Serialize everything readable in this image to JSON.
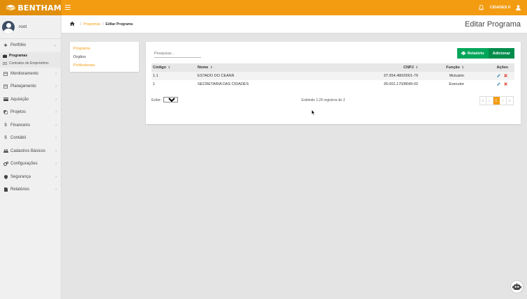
{
  "brand": {
    "name": "BENTHAM"
  },
  "topbar": {
    "user_city": "CIDADES II"
  },
  "user": {
    "name": "root"
  },
  "sidebar": {
    "items": [
      {
        "label": "Portfólio",
        "icon": "plus-icon",
        "expanded": true
      },
      {
        "label": "Monitoramento",
        "icon": "calendar-icon"
      },
      {
        "label": "Planejamento",
        "icon": "calendar-icon"
      },
      {
        "label": "Aquisição",
        "icon": "credit-card-icon"
      },
      {
        "label": "Projetos",
        "icon": "copy-icon"
      },
      {
        "label": "Financeiro",
        "icon": "dollar-icon"
      },
      {
        "label": "Contábil",
        "icon": "dollar-icon"
      },
      {
        "label": "Cadastros Básicos",
        "icon": "users-icon"
      },
      {
        "label": "Configurações",
        "icon": "cogs-icon"
      },
      {
        "label": "Segurança",
        "icon": "shield-icon"
      },
      {
        "label": "Relatórios",
        "icon": "file-icon"
      }
    ],
    "portfolio_sub": [
      {
        "label": "Programas",
        "icon": "briefcase-icon",
        "active": true
      },
      {
        "label": "Contratos de Empréstimo",
        "icon": "money-icon"
      }
    ]
  },
  "breadcrumb": {
    "programas": "Programas",
    "current": "Editar Programa",
    "separator": "/"
  },
  "page": {
    "title": "Editar Programa"
  },
  "tabs": [
    {
      "label": "Programa",
      "active": true
    },
    {
      "label": "Orgãos",
      "active": false
    },
    {
      "label": "Profissionais",
      "active": false
    }
  ],
  "search": {
    "placeholder": "Pesquisar..."
  },
  "buttons": {
    "report": "Relatório",
    "add": "Adicionar"
  },
  "table": {
    "headers": {
      "code": "Código",
      "name": "Nome",
      "cnpj": "CNPJ",
      "role": "Função",
      "actions": "Ações"
    },
    "sort_glyph": "⇕",
    "rows": [
      {
        "code": "1.1",
        "name": "ESTADO DO CEARÁ",
        "cnpj": "07.954.480/0001-79",
        "role": "Mutuário"
      },
      {
        "code": "1",
        "name": "SECRETARIA DAS CIDADES",
        "cnpj": "00.001.170/8649-02",
        "role": "Executor"
      }
    ]
  },
  "footer": {
    "show_label": "Exibir:",
    "page_size": "20",
    "info": "Exibindo 1-20 registros de 2"
  },
  "pagination": {
    "first": "«",
    "prev": "‹",
    "current": "1",
    "next": "›",
    "last": "»"
  },
  "colors": {
    "accent": "#f39c12",
    "brand_bar": "#e08e0b",
    "report_green": "#00a65a",
    "add_green": "#008d4c",
    "delete_red": "#dd4b39",
    "edit_blue": "#3c8dbc"
  }
}
